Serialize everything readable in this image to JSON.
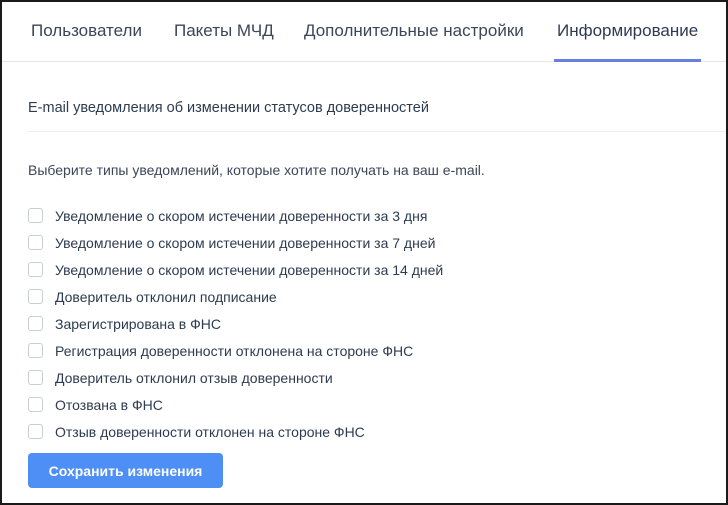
{
  "tabs": [
    {
      "label": "Пользователи",
      "active": false
    },
    {
      "label": "Пакеты МЧД",
      "active": false
    },
    {
      "label": "Дополнительные настройки",
      "active": false
    },
    {
      "label": "Информирование",
      "active": true
    }
  ],
  "section": {
    "title": "E-mail уведомления об изменении статусов доверенностей",
    "description": "Выберите типы уведомлений, которые хотите получать на ваш e-mail."
  },
  "options": [
    {
      "label": "Уведомление о скором истечении доверенности за 3 дня",
      "checked": false
    },
    {
      "label": "Уведомление о скором истечении доверенности за 7 дней",
      "checked": false
    },
    {
      "label": "Уведомление о скором истечении доверенности за 14 дней",
      "checked": false
    },
    {
      "label": "Доверитель отклонил подписание",
      "checked": false
    },
    {
      "label": "Зарегистрирована в ФНС",
      "checked": false
    },
    {
      "label": "Регистрация доверенности отклонена на стороне ФНС",
      "checked": false
    },
    {
      "label": "Доверитель отклонил отзыв доверенности",
      "checked": false
    },
    {
      "label": "Отозвана в ФНС",
      "checked": false
    },
    {
      "label": "Отзыв доверенности отклонен на стороне ФНС",
      "checked": false
    }
  ],
  "actions": {
    "save_label": "Сохранить изменения"
  },
  "colors": {
    "accent": "#4d8ff5",
    "tab_indicator": "#6a7ee0",
    "text": "#2d3b50"
  }
}
